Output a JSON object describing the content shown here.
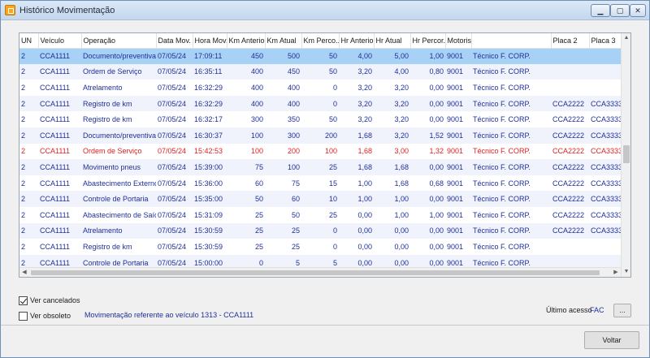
{
  "window": {
    "title": "Histórico Movimentação",
    "min_glyph": "▁",
    "max_glyph": "▢",
    "close_glyph": "✕"
  },
  "table": {
    "columns": [
      "UN",
      "Veículo",
      "Operação",
      "Data Mov.",
      "Hora Mov.",
      "Km Anterior",
      "Km Atual",
      "Km Perco...",
      "Hr Anterior",
      "Hr Atual",
      "Hr Percor...",
      "Motorista",
      "",
      "Placa 2",
      "Placa 3"
    ],
    "rows": [
      [
        "2",
        "CCA1111",
        "Documento/preventiva",
        "07/05/24",
        "17:09:11",
        "450",
        "500",
        "50",
        "4,00",
        "5,00",
        "1,00",
        "9001",
        "Técnico F. CORP.",
        "",
        ""
      ],
      [
        "2",
        "CCA1111",
        "Ordem de Serviço",
        "07/05/24",
        "16:35:11",
        "400",
        "450",
        "50",
        "3,20",
        "4,00",
        "0,80",
        "9001",
        "Técnico F. CORP.",
        "",
        ""
      ],
      [
        "2",
        "CCA1111",
        "Atrelamento",
        "07/05/24",
        "16:32:29",
        "400",
        "400",
        "0",
        "3,20",
        "3,20",
        "0,00",
        "9001",
        "Técnico F. CORP.",
        "",
        ""
      ],
      [
        "2",
        "CCA1111",
        "Registro de km",
        "07/05/24",
        "16:32:29",
        "400",
        "400",
        "0",
        "3,20",
        "3,20",
        "0,00",
        "9001",
        "Técnico F. CORP.",
        "CCA2222",
        "CCA3333"
      ],
      [
        "2",
        "CCA1111",
        "Registro de km",
        "07/05/24",
        "16:32:17",
        "300",
        "350",
        "50",
        "3,20",
        "3,20",
        "0,00",
        "9001",
        "Técnico F. CORP.",
        "CCA2222",
        "CCA3333"
      ],
      [
        "2",
        "CCA1111",
        "Documento/preventiva",
        "07/05/24",
        "16:30:37",
        "100",
        "300",
        "200",
        "1,68",
        "3,20",
        "1,52",
        "9001",
        "Técnico F. CORP.",
        "CCA2222",
        "CCA3333"
      ],
      [
        "2",
        "CCA1111",
        "Ordem de Serviço",
        "07/05/24",
        "15:42:53",
        "100",
        "200",
        "100",
        "1,68",
        "3,00",
        "1,32",
        "9001",
        "Técnico F. CORP.",
        "CCA2222",
        "CCA3333"
      ],
      [
        "2",
        "CCA1111",
        "Movimento pneus",
        "07/05/24",
        "15:39:00",
        "75",
        "100",
        "25",
        "1,68",
        "1,68",
        "0,00",
        "9001",
        "Técnico F. CORP.",
        "CCA2222",
        "CCA3333"
      ],
      [
        "2",
        "CCA1111",
        "Abastecimento Externo",
        "07/05/24",
        "15:36:00",
        "60",
        "75",
        "15",
        "1,00",
        "1,68",
        "0,68",
        "9001",
        "Técnico F. CORP.",
        "CCA2222",
        "CCA3333"
      ],
      [
        "2",
        "CCA1111",
        "Controle de Portaria",
        "07/05/24",
        "15:35:00",
        "50",
        "60",
        "10",
        "1,00",
        "1,00",
        "0,00",
        "9001",
        "Técnico F. CORP.",
        "CCA2222",
        "CCA3333"
      ],
      [
        "2",
        "CCA1111",
        "Abastecimento de Saída",
        "07/05/24",
        "15:31:09",
        "25",
        "50",
        "25",
        "0,00",
        "1,00",
        "1,00",
        "9001",
        "Técnico F. CORP.",
        "CCA2222",
        "CCA3333"
      ],
      [
        "2",
        "CCA1111",
        "Atrelamento",
        "07/05/24",
        "15:30:59",
        "25",
        "25",
        "0",
        "0,00",
        "0,00",
        "0,00",
        "9001",
        "Técnico F. CORP.",
        "CCA2222",
        "CCA3333"
      ],
      [
        "2",
        "CCA1111",
        "Registro de km",
        "07/05/24",
        "15:30:59",
        "25",
        "25",
        "0",
        "0,00",
        "0,00",
        "0,00",
        "9001",
        "Técnico F. CORP.",
        "",
        ""
      ],
      [
        "2",
        "CCA1111",
        "Controle de Portaria",
        "07/05/24",
        "15:00:00",
        "0",
        "5",
        "5",
        "0,00",
        "0,00",
        "0,00",
        "9001",
        "Técnico F. CORP.",
        "",
        ""
      ]
    ],
    "selected_row": 0,
    "cancelled_row": 6,
    "cancelled_color": "#e02020",
    "selected_color": "#a8d2f5"
  },
  "options": {
    "show_cancelled_label": "Ver cancelados",
    "show_cancelled_checked": true,
    "show_obsolete_label": "Ver obsoleto",
    "show_obsolete_checked": false
  },
  "footer": {
    "info_text": "Movimentação referente ao veículo 1313 - CCA1111",
    "last_access_label": "Último acesso",
    "last_access_value": "FAC",
    "dots_label": "...",
    "back_label": "Voltar"
  }
}
